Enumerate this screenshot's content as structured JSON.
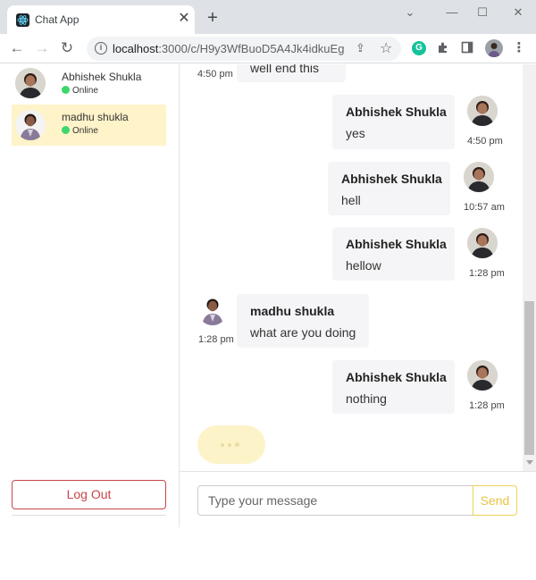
{
  "browser": {
    "tab_title": "Chat App",
    "tab_close": "✕",
    "new_tab": "+",
    "window_controls": {
      "chevron": "⌄",
      "minimize": "—",
      "maximize": "☐",
      "close": "✕"
    },
    "nav": {
      "back": "←",
      "forward": "→",
      "reload": "↻"
    },
    "url_host": "localhost",
    "url_rest": ":3000/c/H9y3WfBuoD5A4Jk4idkuEg",
    "icons": [
      "info-icon",
      "share-icon",
      "star-icon",
      "grammarly-icon",
      "extensions-icon",
      "side-panel-icon",
      "profile-avatar",
      "menu-icon"
    ]
  },
  "sidebar": {
    "contacts": [
      {
        "name": "Abhishek Shukla",
        "status": "Online",
        "active": false
      },
      {
        "name": "madhu shukla",
        "status": "Online",
        "active": true
      }
    ],
    "logout_label": "Log Out"
  },
  "chat": {
    "partial_message": {
      "text": "well end this",
      "time": "4:50 pm"
    },
    "messages": [
      {
        "sender": "Abhishek Shukla",
        "text": "yes",
        "time": "4:50 pm",
        "side": "right"
      },
      {
        "sender": "Abhishek Shukla",
        "text": "hell",
        "time": "10:57 am",
        "side": "right"
      },
      {
        "sender": "Abhishek Shukla",
        "text": "hellow",
        "time": "1:28 pm",
        "side": "right"
      },
      {
        "sender": "madhu shukla",
        "text": "what are you doing",
        "time": "1:28 pm",
        "side": "left"
      },
      {
        "sender": "Abhishek Shukla",
        "text": "nothing",
        "time": "1:28 pm",
        "side": "right"
      }
    ],
    "typing_indicator": true
  },
  "composer": {
    "placeholder": "Type your message",
    "value": "",
    "send_label": "Send"
  },
  "colors": {
    "accent_yellow": "#f1cf58",
    "active_contact_bg": "#fff3c9",
    "online_dot": "#3bd86b",
    "logout_red": "#c8464b",
    "bubble_bg": "#f5f5f7"
  }
}
